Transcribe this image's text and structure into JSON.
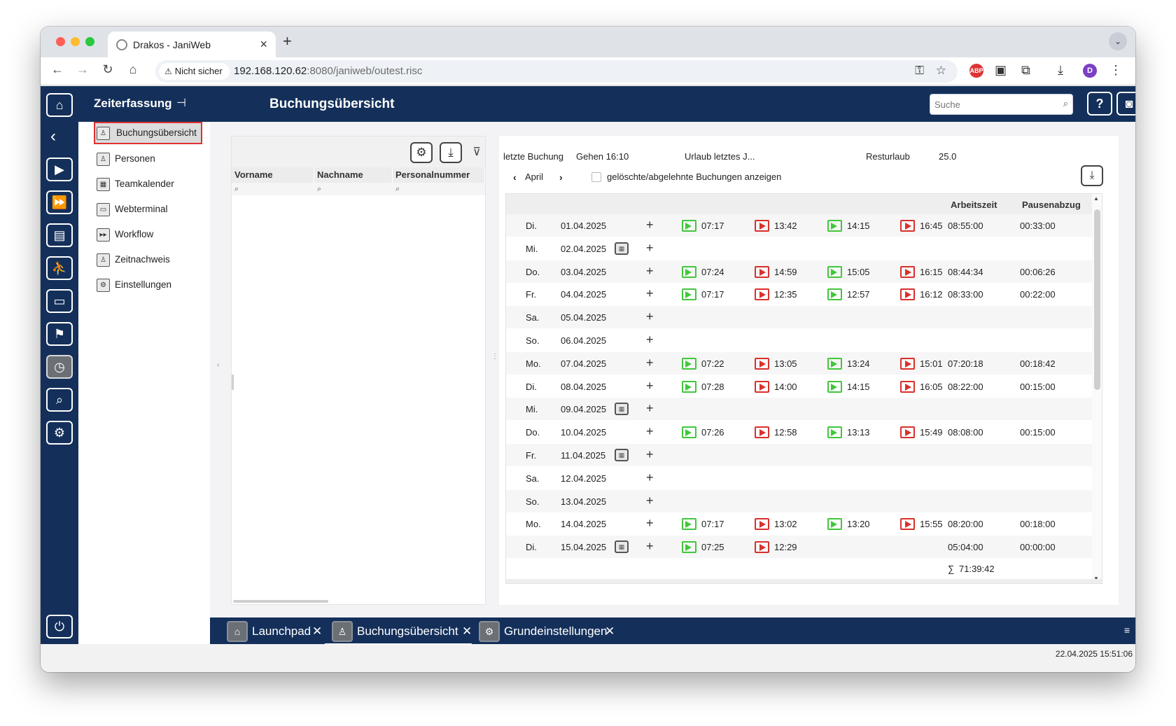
{
  "browser": {
    "tab_title": "Drakos - JaniWeb",
    "security_label": "Nicht sicher",
    "url_host": "192.168.120.62",
    "url_path": ":8080/janiweb/outest.risc",
    "profile_letter": "D",
    "ext_badge": "ABP"
  },
  "header": {
    "nav_title": "Zeiterfassung",
    "page_title": "Buchungsübersicht",
    "search_placeholder": "Suche"
  },
  "nav": {
    "items": [
      {
        "label": "Buchungsübersicht",
        "selected": true
      },
      {
        "label": "Personen"
      },
      {
        "label": "Teamkalender"
      },
      {
        "label": "Webterminal"
      },
      {
        "label": "Workflow"
      },
      {
        "label": "Zeitnachweis"
      },
      {
        "label": "Einstellungen"
      }
    ]
  },
  "person_list": {
    "columns": [
      "Vorname",
      "Nachname",
      "Personalnummer"
    ]
  },
  "booking": {
    "last_label": "letzte Buchung",
    "last_value": "Gehen 16:10",
    "vacation_label": "Urlaub letztes J...",
    "rest_label": "Resturlaub",
    "rest_value": "25.0",
    "month": "April",
    "show_deleted_label": "gelöschte/abgelehnte Buchungen anzeigen",
    "col_worktime": "Arbeitszeit",
    "col_break": "Pausenabzug",
    "rows": [
      {
        "day": "Di.",
        "date": "01.04.2025",
        "cal": false,
        "t1": "07:17",
        "t2": "13:42",
        "t3": "14:15",
        "t4": "16:45",
        "work": "08:55:00",
        "brk": "00:33:00"
      },
      {
        "day": "Mi.",
        "date": "02.04.2025",
        "cal": true,
        "t1": "",
        "t2": "",
        "t3": "",
        "t4": "",
        "work": "",
        "brk": ""
      },
      {
        "day": "Do.",
        "date": "03.04.2025",
        "cal": false,
        "t1": "07:24",
        "t2": "14:59",
        "t3": "15:05",
        "t4": "16:15",
        "work": "08:44:34",
        "brk": "00:06:26"
      },
      {
        "day": "Fr.",
        "date": "04.04.2025",
        "cal": false,
        "t1": "07:17",
        "t2": "12:35",
        "t3": "12:57",
        "t4": "16:12",
        "work": "08:33:00",
        "brk": "00:22:00"
      },
      {
        "day": "Sa.",
        "date": "05.04.2025",
        "cal": false,
        "t1": "",
        "t2": "",
        "t3": "",
        "t4": "",
        "work": "",
        "brk": ""
      },
      {
        "day": "So.",
        "date": "06.04.2025",
        "cal": false,
        "t1": "",
        "t2": "",
        "t3": "",
        "t4": "",
        "work": "",
        "brk": ""
      },
      {
        "day": "Mo.",
        "date": "07.04.2025",
        "cal": false,
        "t1": "07:22",
        "t2": "13:05",
        "t3": "13:24",
        "t4": "15:01",
        "work": "07:20:18",
        "brk": "00:18:42"
      },
      {
        "day": "Di.",
        "date": "08.04.2025",
        "cal": false,
        "t1": "07:28",
        "t2": "14:00",
        "t3": "14:15",
        "t4": "16:05",
        "work": "08:22:00",
        "brk": "00:15:00"
      },
      {
        "day": "Mi.",
        "date": "09.04.2025",
        "cal": true,
        "t1": "",
        "t2": "",
        "t3": "",
        "t4": "",
        "work": "",
        "brk": ""
      },
      {
        "day": "Do.",
        "date": "10.04.2025",
        "cal": false,
        "t1": "07:26",
        "t2": "12:58",
        "t3": "13:13",
        "t4": "15:49",
        "work": "08:08:00",
        "brk": "00:15:00"
      },
      {
        "day": "Fr.",
        "date": "11.04.2025",
        "cal": true,
        "t1": "",
        "t2": "",
        "t3": "",
        "t4": "",
        "work": "",
        "brk": ""
      },
      {
        "day": "Sa.",
        "date": "12.04.2025",
        "cal": false,
        "t1": "",
        "t2": "",
        "t3": "",
        "t4": "",
        "work": "",
        "brk": ""
      },
      {
        "day": "So.",
        "date": "13.04.2025",
        "cal": false,
        "t1": "",
        "t2": "",
        "t3": "",
        "t4": "",
        "work": "",
        "brk": ""
      },
      {
        "day": "Mo.",
        "date": "14.04.2025",
        "cal": false,
        "t1": "07:17",
        "t2": "13:02",
        "t3": "13:20",
        "t4": "15:55",
        "work": "08:20:00",
        "brk": "00:18:00"
      },
      {
        "day": "Di.",
        "date": "15.04.2025",
        "cal": true,
        "t1": "07:25",
        "t2": "12:29",
        "t3": "",
        "t4": "",
        "work": "05:04:00",
        "brk": "00:00:00"
      }
    ],
    "sum_symbol": "∑",
    "sum_value": "71:39:42"
  },
  "taskbar": {
    "tabs": [
      {
        "label": "Launchpad",
        "active": false
      },
      {
        "label": "Buchungsübersicht",
        "active": true
      },
      {
        "label": "Grundeinstellungen",
        "active": false
      }
    ]
  },
  "status": {
    "datetime": "22.04.2025 15:51:06"
  },
  "colors": {
    "brand_navy": "#14305a",
    "in_green": "#41c73b",
    "out_red": "#d9302c",
    "selection_border": "#e03131"
  }
}
